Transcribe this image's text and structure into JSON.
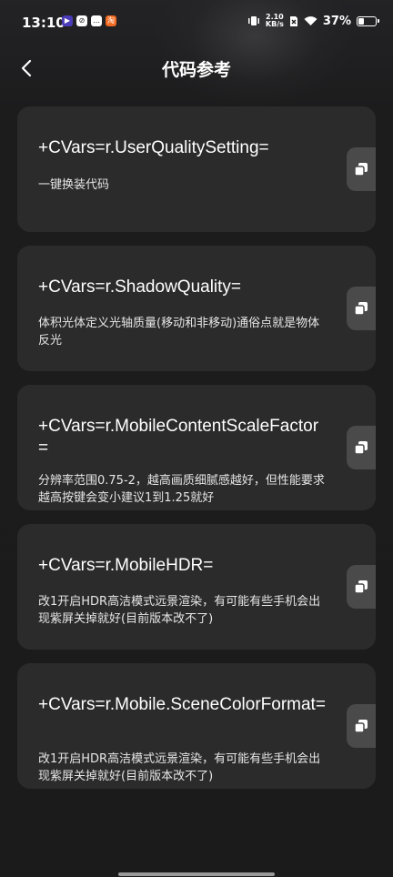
{
  "status_bar": {
    "time": "13:10",
    "net_speed_value": "2.10",
    "net_speed_unit": "KB/s",
    "battery_percent": "37%",
    "battery_level": 0.37,
    "app_icons": [
      "media-player-icon",
      "link-app-icon",
      "message-app-icon",
      "store-app-icon"
    ]
  },
  "header": {
    "title": "代码参考",
    "back_icon": "chevron-left-icon"
  },
  "cards": [
    {
      "code": "+CVars=r.UserQualitySetting=",
      "desc": "一键换装代码"
    },
    {
      "code": "+CVars=r.ShadowQuality=",
      "desc": "体积光体定义光轴质量(移动和非移动)通俗点就是物体反光"
    },
    {
      "code": "+CVars=r.MobileContentScaleFactor=",
      "desc": "分辨率范围0.75-2，越高画质细腻感越好，但性能要求越高按键会变小建议1到1.25就好"
    },
    {
      "code": "+CVars=r.MobileHDR=",
      "desc": "改1开启HDR高洁模式远景渲染，有可能有些手机会出现紫屏关掉就好(目前版本改不了)"
    },
    {
      "code": "+CVars=r.Mobile.SceneColorFormat=",
      "desc": "改1开启HDR高洁模式远景渲染，有可能有些手机会出现紫屏关掉就好(目前版本改不了)"
    }
  ],
  "copy_icon": "copy-icon"
}
